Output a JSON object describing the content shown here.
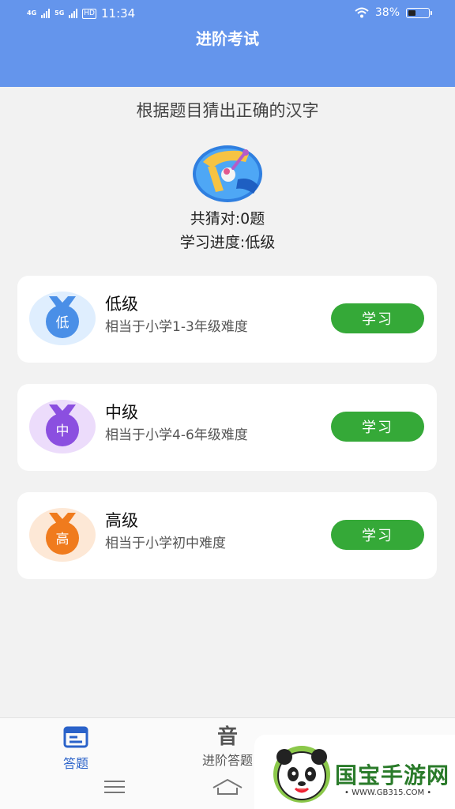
{
  "status_bar": {
    "signal_1": "4G",
    "signal_2": "5G",
    "hd": "HD",
    "time": "11:34",
    "battery_pct": "38%",
    "battery_level": 0.38
  },
  "header": {
    "title": "进阶考试"
  },
  "main": {
    "subtitle": "根据题目猜出正确的汉字",
    "stats": {
      "correct": "共猜对:0题",
      "progress": "学习进度:低级"
    },
    "levels": [
      {
        "name": "低级",
        "desc": "相当于小学1-3年级难度",
        "badge": "低",
        "button": "学习",
        "color": "#4a8fe7",
        "bg": "#dfeefe"
      },
      {
        "name": "中级",
        "desc": "相当于小学4-6年级难度",
        "badge": "中",
        "button": "学习",
        "color": "#8b4fe0",
        "bg": "#ecdcfb"
      },
      {
        "name": "高级",
        "desc": "相当于小学初中难度",
        "badge": "高",
        "button": "学习",
        "color": "#f07b1d",
        "bg": "#fde8d6"
      }
    ]
  },
  "tabs": [
    {
      "label": "答题",
      "icon": "quiz-icon",
      "active": true
    },
    {
      "label": "进阶答题",
      "icon": "音",
      "active": false
    }
  ],
  "watermark": {
    "text": "国宝手游网",
    "url": "• WWW.GB315.COM •"
  }
}
